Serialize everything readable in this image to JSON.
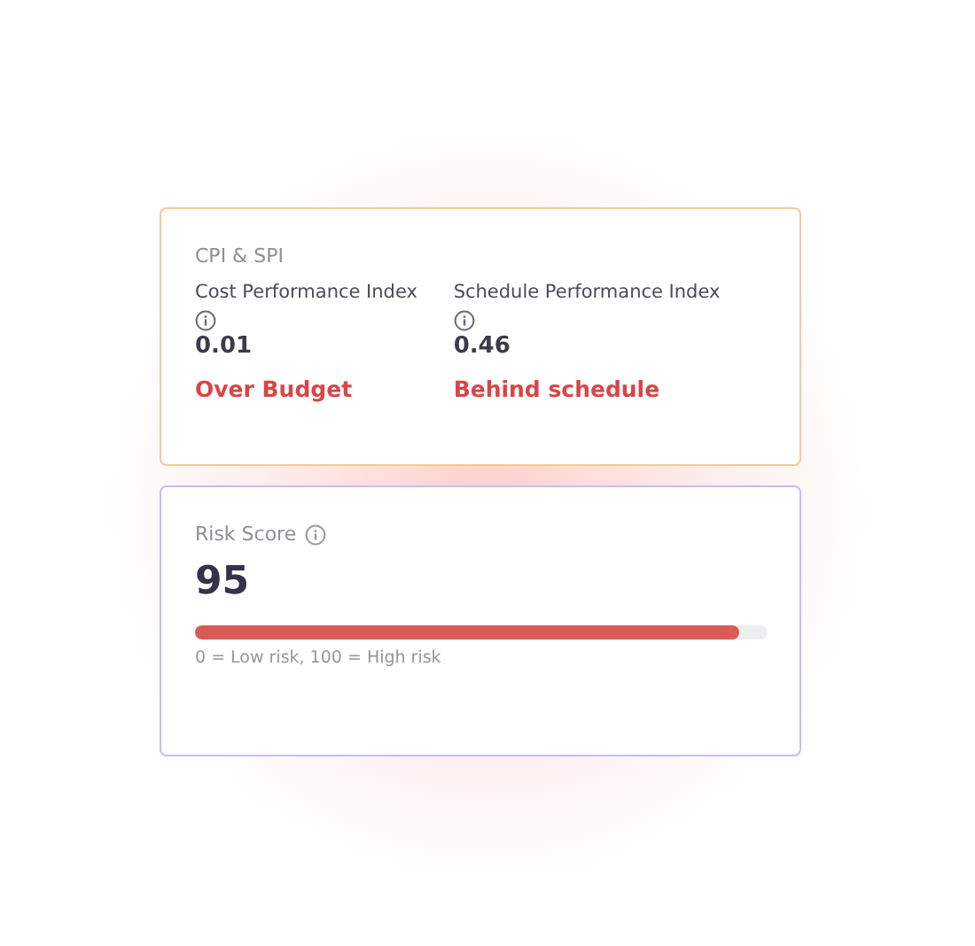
{
  "cpi_spi_card": {
    "title": "CPI & SPI",
    "metrics": [
      {
        "label": "Cost Performance Index",
        "value": "0.01",
        "status": "Over Budget"
      },
      {
        "label": "Schedule Performance Index",
        "value": "0.46",
        "status": "Behind schedule"
      }
    ]
  },
  "risk_card": {
    "title": "Risk Score",
    "value": "95",
    "level": 0.95,
    "legend": "0 = Low risk, 100 = High risk"
  }
}
